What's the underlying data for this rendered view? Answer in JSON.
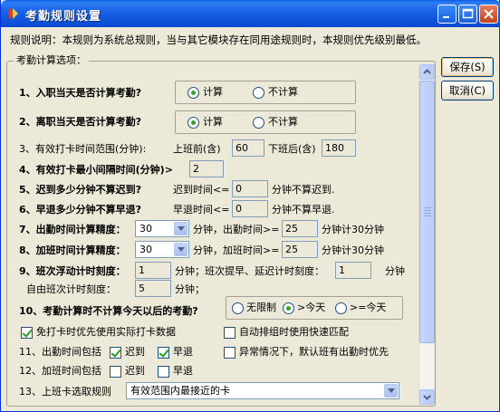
{
  "window": {
    "title": "考勤规则设置"
  },
  "description": "规则说明：本规则为系统总规则，当与其它模块存在同用途规则时，本规则优先级别最低。",
  "group": {
    "legend": "考勤计算选项："
  },
  "rows": {
    "r1": {
      "label": "1、入职当天是否计算考勤?",
      "opt_yes": "计算",
      "opt_no": "不计算",
      "selected": "计算"
    },
    "r2": {
      "label": "2、离职当天是否计算考勤?",
      "opt_yes": "计算",
      "opt_no": "不计算",
      "selected": "计算"
    },
    "r3": {
      "label": "3、有效打卡时间范围(分钟):",
      "before_label": "上班前(含)",
      "before_value": "60",
      "after_label": "下班后(含)",
      "after_value": "180"
    },
    "r4": {
      "label": "4、有效打卡最小间隔时间(分钟)>",
      "value": "2"
    },
    "r5": {
      "label": "5、迟到多少分钟不算迟到?",
      "pre": "迟到时间<=",
      "value": "0",
      "post": "分钟不算迟到."
    },
    "r6": {
      "label": "6、早退多少分钟不算早退?",
      "pre": "早退时间<=",
      "value": "0",
      "post": "分钟不算早退."
    },
    "r7": {
      "label": "7、出勤时间计算精度：",
      "combo_value": "30",
      "mid": "分钟，出勤时间>=",
      "value": "25",
      "post": "分钟计30分钟"
    },
    "r8": {
      "label": "8、加班时间计算精度：",
      "combo_value": "30",
      "mid": "分钟，加班时间>=",
      "value": "25",
      "post": "分钟计30分钟"
    },
    "r9": {
      "label": "9、班次浮动计时刻度：",
      "value1": "1",
      "mid": "分钟；班次提早、延迟计时刻度：",
      "value2": "1",
      "post": "分钟",
      "sub_label": "自由班次计时刻度：",
      "sub_value": "5",
      "sub_post": "分钟；"
    },
    "r10": {
      "label": "10、考勤计算时不计算今天以后的考勤?",
      "opt1": "无限制",
      "opt2": ">今天",
      "opt3": ">=今天",
      "selected": ">今天"
    },
    "c1": {
      "label": "免打卡时优先使用实际打卡数据",
      "checked": true
    },
    "c2": {
      "label": "自动排组时使用快速匹配",
      "checked": false
    },
    "r11": {
      "label": "11、出勤时间包括",
      "late": "迟到",
      "early": "早退",
      "late_checked": true,
      "early_checked": true
    },
    "c3": {
      "label": "异常情况下，默认班有出勤时优先",
      "checked": false
    },
    "r12": {
      "label": "12、加班时间包括",
      "late": "迟到",
      "early": "早退",
      "late_checked": false,
      "early_checked": false
    },
    "r13": {
      "label": "13、上班卡选取规则",
      "combo_value": "有效范围内最接近的卡"
    }
  },
  "buttons": {
    "save": "保存(S)",
    "cancel": "取消(C)"
  }
}
